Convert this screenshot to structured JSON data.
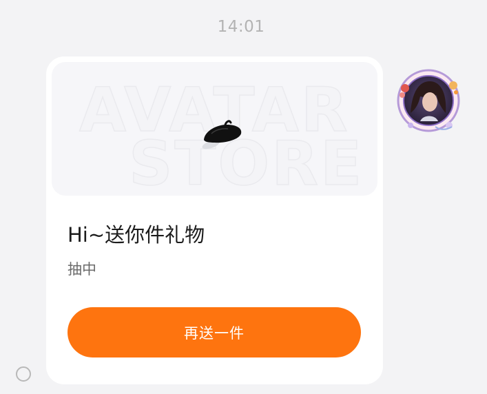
{
  "message": {
    "timestamp": "14:01"
  },
  "gift_card": {
    "banner_watermark_line1": "AVATAR",
    "banner_watermark_line2": "STORE",
    "item_icon": "beret-hat-icon",
    "title": "Hi~送你件礼物",
    "subtitle": "抽中",
    "action_label": "再送一件"
  },
  "sender": {
    "avatar_icon": "user-avatar-icon"
  },
  "status": {
    "icon": "unread-status-ring-icon"
  },
  "colors": {
    "background": "#f3f3f5",
    "card": "#ffffff",
    "accent_button": "#fe740f",
    "timestamp_text": "#b3b3b3"
  }
}
